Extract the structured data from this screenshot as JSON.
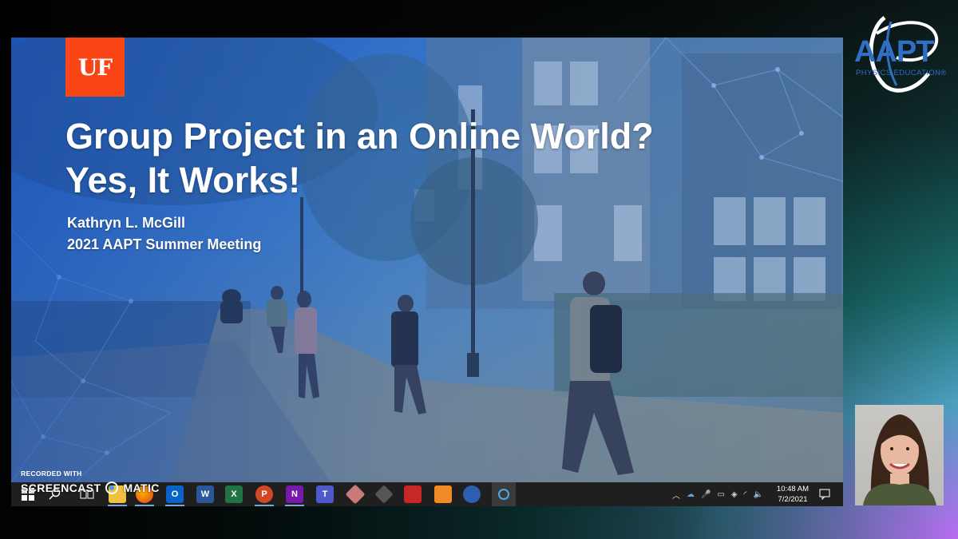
{
  "slide": {
    "logo_text": "UF",
    "title_line1": "Group Project in an Online World?",
    "title_line2": "Yes, It Works!",
    "author": "Kathryn L. McGill",
    "event": "2021 AAPT Summer Meeting"
  },
  "recorder": {
    "recorded_with": "RECORDED WITH",
    "brand_left": "SCREENCAST",
    "brand_right": "MATIC"
  },
  "taskbar": {
    "apps": [
      {
        "name": "windows-start",
        "label": ""
      },
      {
        "name": "search",
        "label": ""
      },
      {
        "name": "task-view",
        "label": ""
      },
      {
        "name": "file-explorer",
        "label": ""
      },
      {
        "name": "firefox",
        "label": ""
      },
      {
        "name": "outlook",
        "label": "O"
      },
      {
        "name": "word",
        "label": "W"
      },
      {
        "name": "excel",
        "label": "X"
      },
      {
        "name": "powerpoint",
        "label": "P"
      },
      {
        "name": "onenote",
        "label": "N"
      },
      {
        "name": "teams",
        "label": "T"
      }
    ],
    "time": "10:48 AM",
    "date": "7/2/2021"
  },
  "aapt_logo": {
    "text": "AAPT",
    "subtext": "PHYSICS EDUCATION®"
  },
  "colors": {
    "uf_orange": "#fa4616",
    "aapt_blue": "#2f6fc4",
    "taskbar": "#1f1f1f"
  }
}
